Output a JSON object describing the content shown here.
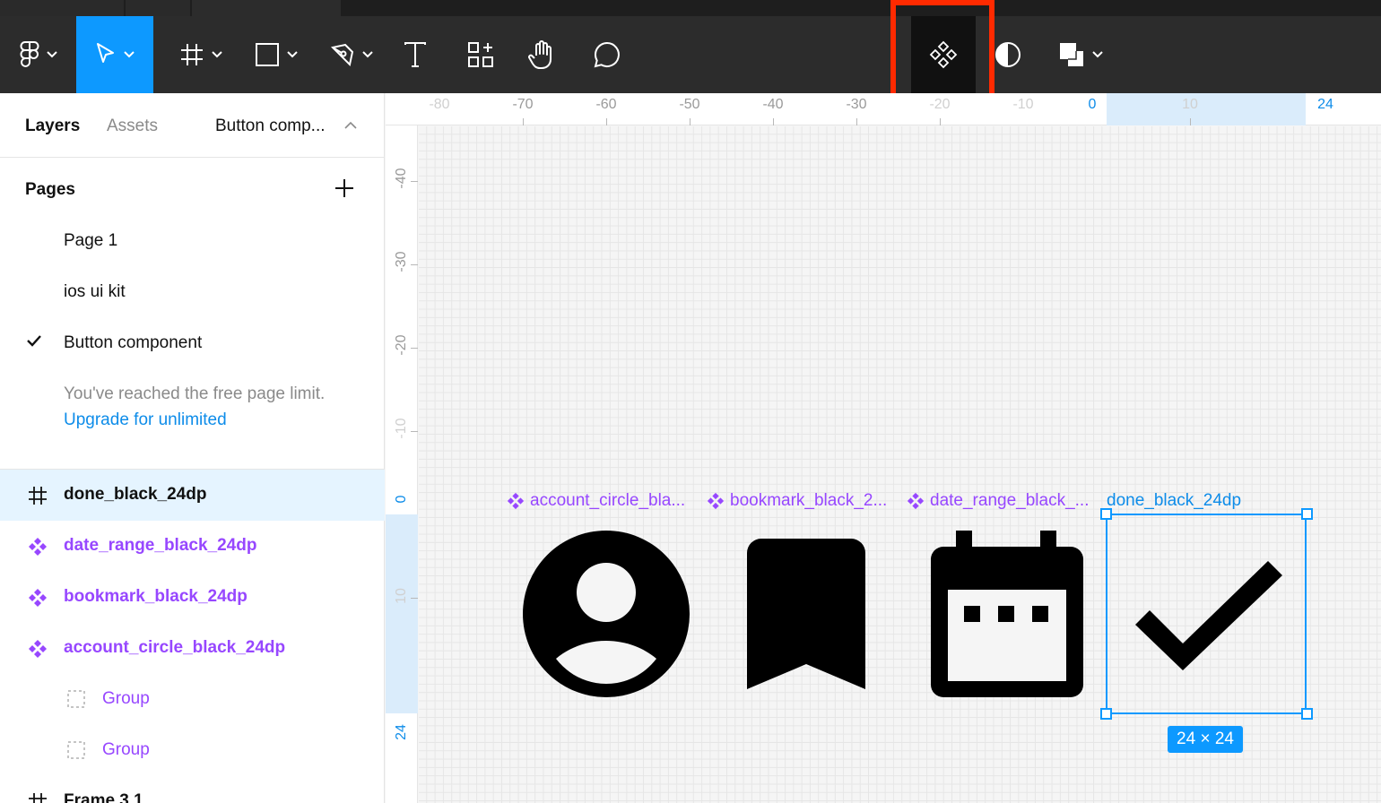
{
  "sidebar": {
    "tabs": {
      "layers": "Layers",
      "assets": "Assets",
      "current_page": "Button comp..."
    },
    "pages_title": "Pages",
    "pages": [
      {
        "label": "Page 1"
      },
      {
        "label": "ios ui kit"
      },
      {
        "label": "Button component",
        "selected": true
      }
    ],
    "limit_notice": "You've reached the free page limit.",
    "upgrade_link": "Upgrade for unlimited",
    "layers": [
      {
        "label": "done_black_24dp",
        "kind": "frame",
        "selected": true
      },
      {
        "label": "date_range_black_24dp",
        "kind": "component"
      },
      {
        "label": "bookmark_black_24dp",
        "kind": "component"
      },
      {
        "label": "account_circle_black_24dp",
        "kind": "component"
      },
      {
        "label": "Group",
        "kind": "group"
      },
      {
        "label": "Group",
        "kind": "group"
      },
      {
        "label": "Frame 3.1",
        "kind": "frame"
      }
    ]
  },
  "toolbar": {
    "tools": [
      "figma-menu",
      "move",
      "frame",
      "rectangle",
      "pen",
      "text",
      "resources",
      "hand",
      "comment",
      "create-component",
      "mask",
      "boolean"
    ],
    "active": "move",
    "highlighted": "create-component"
  },
  "rulers": {
    "top": [
      "-80",
      "-70",
      "-60",
      "-50",
      "-40",
      "-30",
      "-20",
      "-10",
      "0",
      "10",
      "24"
    ],
    "left": [
      "-40",
      "-30",
      "-20",
      "-10",
      "0",
      "10",
      "24"
    ]
  },
  "canvas": {
    "labels": {
      "account": "account_circle_bla...",
      "bookmark": "bookmark_black_2...",
      "date": "date_range_black_...",
      "done": "done_black_24dp"
    },
    "size_badge": "24 × 24"
  },
  "colors": {
    "accent": "#0d99ff",
    "component": "#9747ff",
    "highlight": "#ff2a00",
    "toolbar": "#2c2c2c"
  }
}
